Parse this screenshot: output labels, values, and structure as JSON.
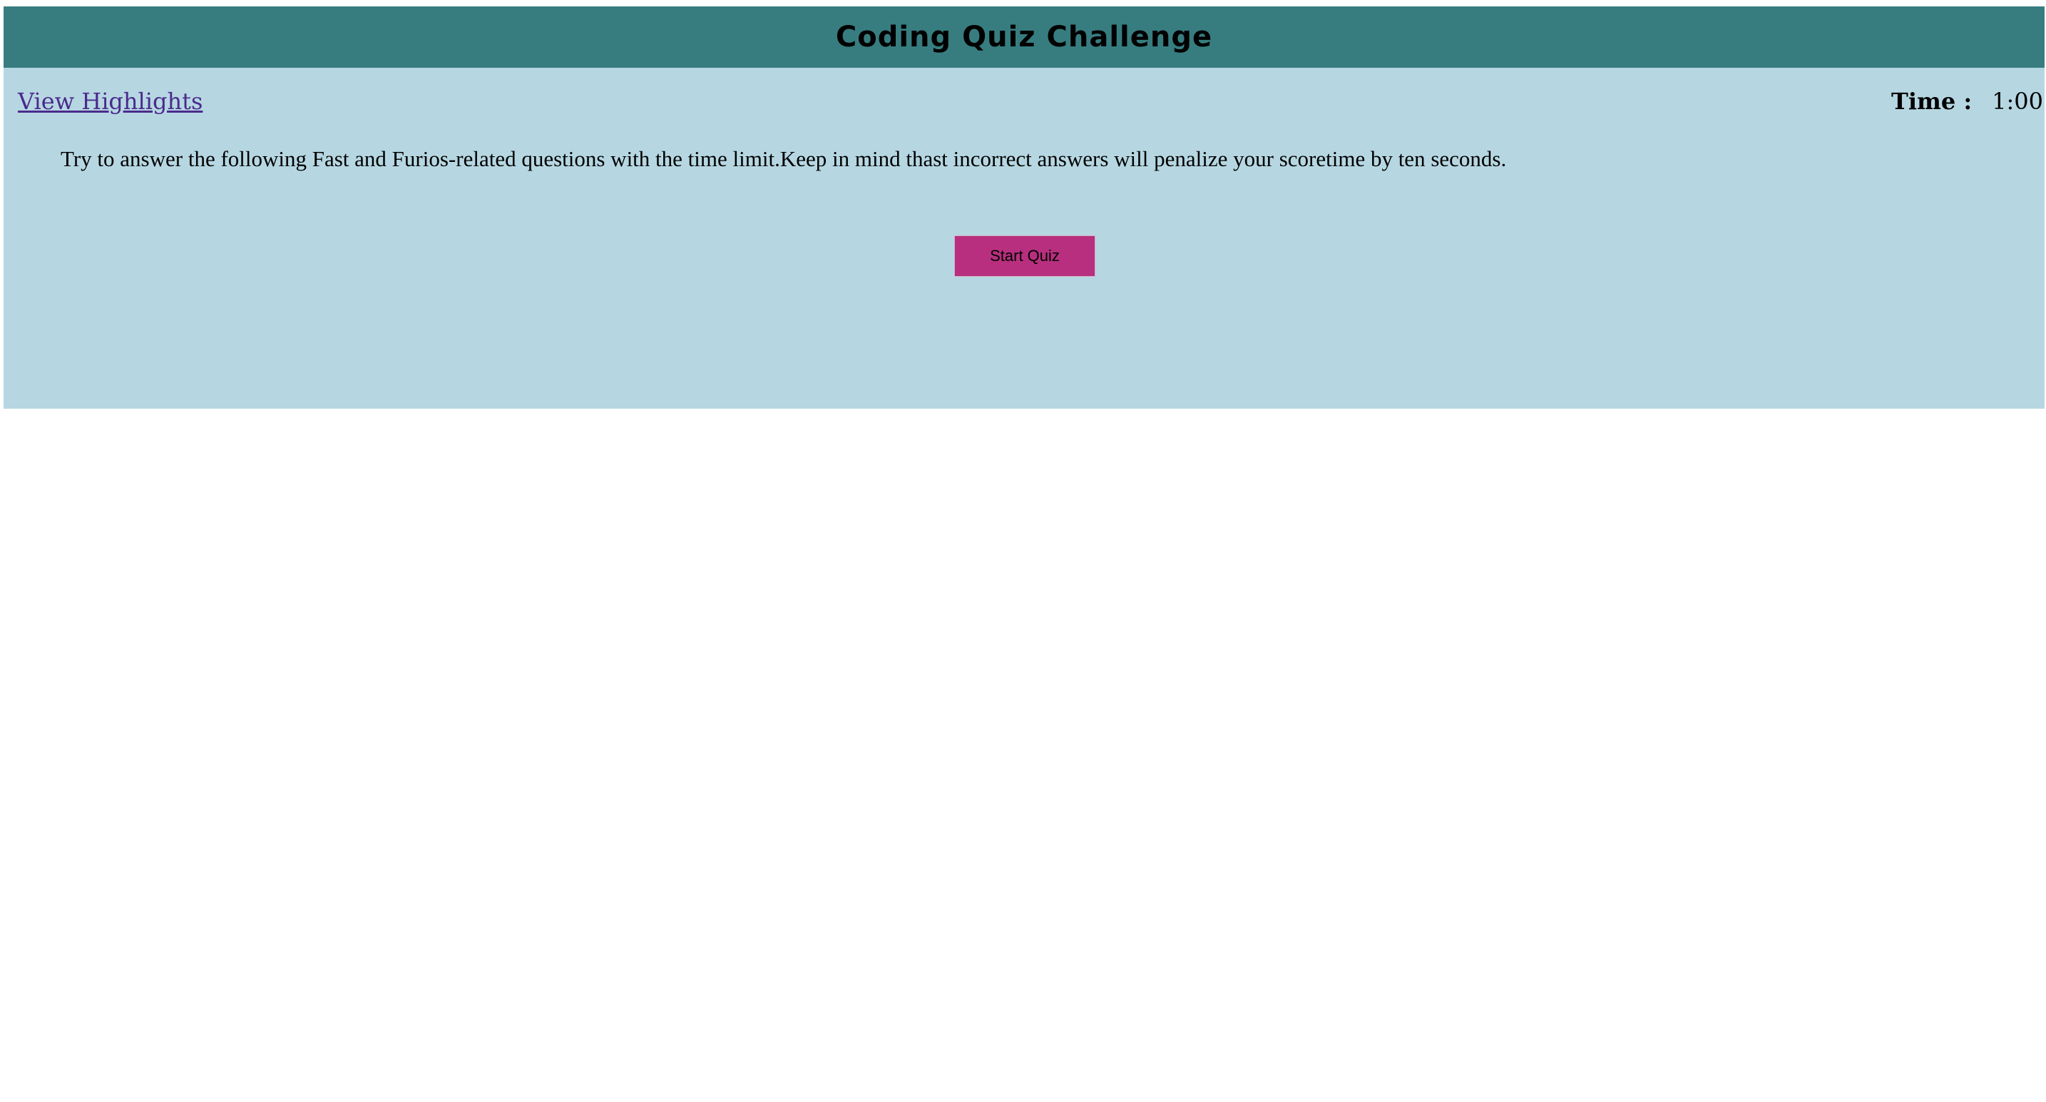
{
  "header": {
    "title": "Coding Quiz Challenge"
  },
  "nav": {
    "highlights_link": "View Highlights"
  },
  "timer": {
    "label": "Time :",
    "value": "1:00"
  },
  "intro": {
    "text": "Try to answer the following Fast and Furios-related questions with the time limit.Keep in mind thast incorrect answers will penalize your scoretime by ten seconds."
  },
  "actions": {
    "start_label": "Start Quiz"
  },
  "colors": {
    "header_bg": "#377d80",
    "panel_bg": "#b6d7e2",
    "start_button_bg": "#b72f7e",
    "link_color": "#4b2a8c"
  }
}
